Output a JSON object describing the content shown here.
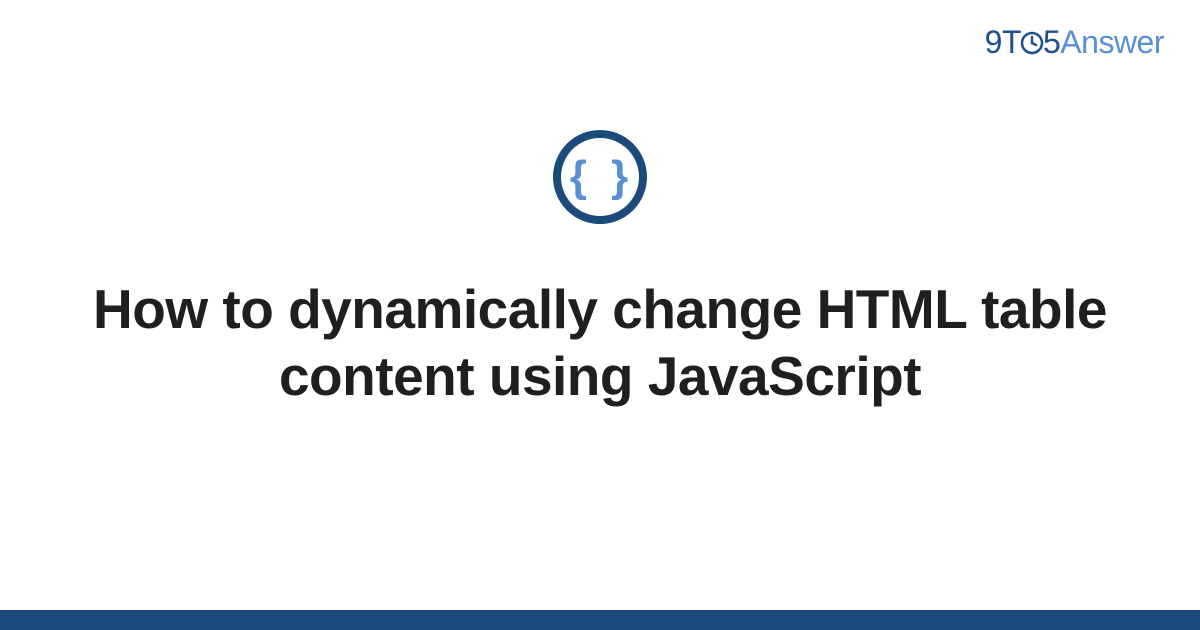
{
  "header": {
    "logo": {
      "part1": "9T",
      "part2": "5",
      "answer": "Answer"
    }
  },
  "main": {
    "icon_name": "braces-icon",
    "icon_glyph": "{ }",
    "title": "How to dynamically change HTML table content using JavaScript"
  },
  "colors": {
    "brand_dark": "#1a4b7a",
    "brand_light": "#5a8fd4",
    "text": "#1f1f1f"
  }
}
